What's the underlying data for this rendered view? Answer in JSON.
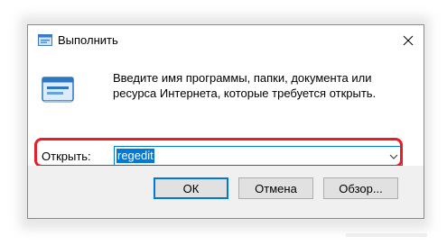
{
  "window": {
    "title": "Выполнить",
    "close_icon": "close-icon",
    "title_icon": "run-app-icon"
  },
  "content": {
    "description": "Введите имя программы, папки, документа или ресурса Интернета, которые требуется открыть.",
    "big_icon": "run-app-icon"
  },
  "open_field": {
    "label": "Открыть:",
    "value": "regedit",
    "dropdown_icon": "chevron-down-icon"
  },
  "buttons": {
    "ok": "ОК",
    "cancel": "Отмена",
    "browse": "Обзор..."
  },
  "colors": {
    "accent": "#0078d7",
    "highlight": "#e3202a",
    "dialog_bg": "#f0f0f0",
    "button_bg": "#e1e1e1"
  }
}
